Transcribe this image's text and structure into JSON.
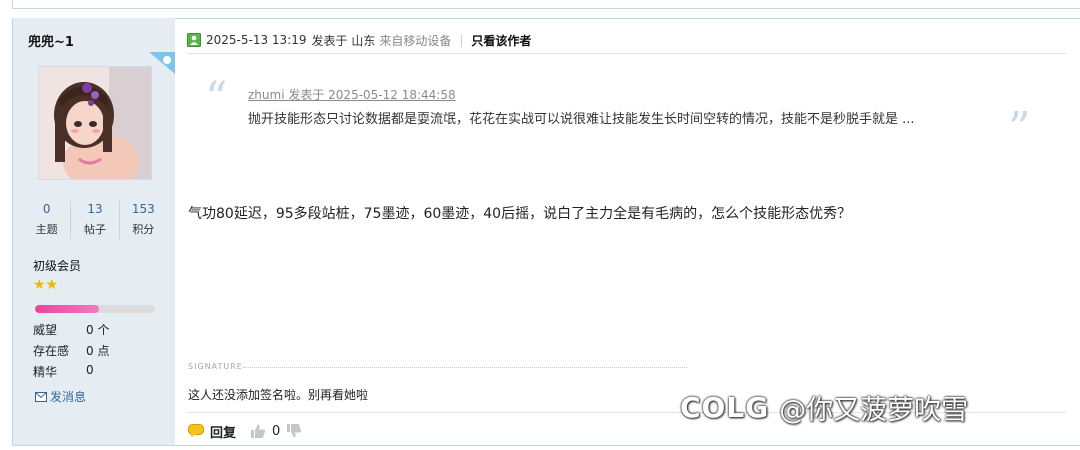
{
  "sidebar": {
    "username": "兜兜~1",
    "stats": [
      {
        "value": "0",
        "label": "主题"
      },
      {
        "value": "13",
        "label": "帖子"
      },
      {
        "value": "153",
        "label": "积分"
      }
    ],
    "rank": "初级会员",
    "stars": "★★",
    "progress_fraction": 0.53,
    "properties": [
      {
        "label": "威望",
        "value": "0 个"
      },
      {
        "label": "存在感",
        "value": "0 点"
      },
      {
        "label": "精华",
        "value": "0"
      }
    ],
    "message_link": "发消息"
  },
  "post": {
    "datetime": "2025-5-13 13:19",
    "posted_in": "发表于 山东",
    "device": "来自移动设备",
    "author_only": "只看该作者",
    "quote_meta": "zhumi 发表于 2025-05-12 18:44:58",
    "quote_text": "抛开技能形态只讨论数据都是耍流氓，花花在实战可以说很难让技能发生长时间空转的情况，技能不是秒脱手就是 ...",
    "body": "气功80延迟，95多段站桩，75墨迹，60墨迹，40后摇，说白了主力全是有毛病的，怎么个技能形态优秀？",
    "signature_label": "SIGNATURE",
    "signature_text": "这人还没添加签名啦。别再看她啦",
    "reply_label": "回复",
    "like_count": "0"
  },
  "watermark": {
    "logo": "COLG",
    "text": "@你又菠萝吹雪"
  },
  "colors": {
    "sidebar_bg": "#e5edf2",
    "link": "#336699",
    "border": "#c2d5e3",
    "progress": "#e8449a",
    "star": "#f2b600"
  }
}
